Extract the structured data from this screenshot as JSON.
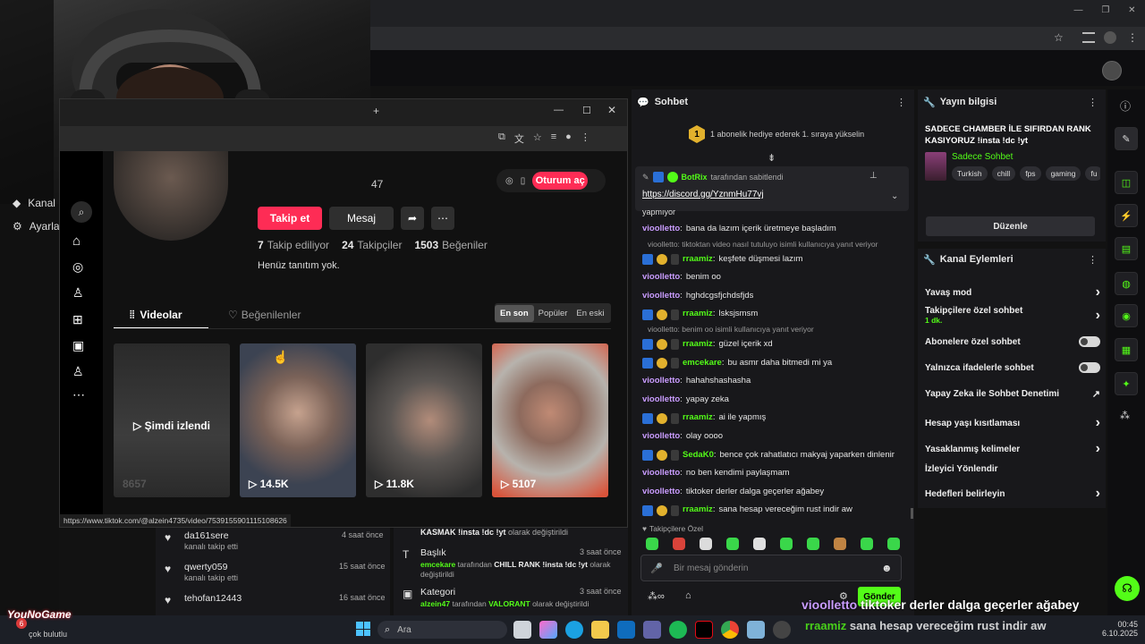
{
  "chrome": {
    "minimize": "—",
    "restore": "❐",
    "close": "✕"
  },
  "left_nav": {
    "item1": "Kanal",
    "item2": "Ayarlar"
  },
  "tiktok": {
    "login_button": "Oturum aç",
    "username_fragment": "47",
    "follow_label": "Takip et",
    "message_label": "Mesaj",
    "following_count": "7",
    "following_label": "Takip ediliyor",
    "followers_count": "24",
    "followers_label": "Takipçiler",
    "likes_count": "1503",
    "likes_label": "Beğeniler",
    "bio": "Henüz tanıtım yok.",
    "tab_videos": "Videolar",
    "tab_liked": "Beğenilenler",
    "sort_latest": "En son",
    "sort_popular": "Popüler",
    "sort_oldest": "En eski",
    "now_watched": "Şimdi izlendi",
    "videos": [
      {
        "views": "8657"
      },
      {
        "views": "14.5K"
      },
      {
        "views": "11.8K"
      },
      {
        "views": "5107"
      }
    ],
    "status_url": "https://www.tiktok.com/@alzein4735/video/7539155901115108626"
  },
  "feed_left": [
    {
      "name": "da161sere",
      "action": "kanalı takip etti",
      "time": "4 saat önce"
    },
    {
      "name": "qwerty059",
      "action": "kanalı takip etti",
      "time": "15 saat önce"
    },
    {
      "name": "tehofan12443",
      "action": "",
      "time": "16 saat önce"
    }
  ],
  "feed_mid": {
    "top_text": "KASMAK !insta !dc !yt",
    "top_suffix": "olarak değiştirildi",
    "title_label": "Başlık",
    "title_time": "3 saat önce",
    "title_user": "emcekare",
    "title_mid": "tarafından",
    "title_value": "CHILL RANK !insta !dc !yt",
    "title_suffix": "olarak değiştirildi",
    "cat_label": "Kategori",
    "cat_time": "3 saat önce",
    "cat_user": "alzein47",
    "cat_mid": "tarafından",
    "cat_value": "VALORANT",
    "cat_suffix": "olarak değiştirildi"
  },
  "chat": {
    "header": "Sohbet",
    "gift_text": "1 abonelik hediye ederek 1. sıraya yükselin",
    "gift_rank": "1",
    "pinned_by_user": "BotRix",
    "pinned_by_text": "tarafından sabitlendi",
    "pinned_link": "https://discord.gg/YznmHu77vj",
    "partial_top": "yapmıyor",
    "messages": [
      {
        "type": "msg",
        "user": "vioolletto",
        "color": "purple",
        "badges": false,
        "text": "bana da lazım içerik üretmeye başladım"
      },
      {
        "type": "reply",
        "text": "vioolletto: tiktoktan video nasıl tutuluyo isimli kullanıcıya yanıt veriyor"
      },
      {
        "type": "msg",
        "user": "rraamiz",
        "color": "green",
        "badges": true,
        "text": "keşfete düşmesi lazım"
      },
      {
        "type": "msg",
        "user": "vioolletto",
        "color": "purple",
        "badges": false,
        "text": "benim oo"
      },
      {
        "type": "msg",
        "user": "vioolletto",
        "color": "purple",
        "badges": false,
        "text": "hghdcgsfjchdsfjds"
      },
      {
        "type": "msg",
        "user": "rraamiz",
        "color": "green",
        "badges": true,
        "text": "lsksjsmsm"
      },
      {
        "type": "reply",
        "text": "vioolletto: benim oo isimli kullanıcıya yanıt veriyor"
      },
      {
        "type": "msg",
        "user": "rraamiz",
        "color": "green",
        "badges": true,
        "text": "güzel içerik xd"
      },
      {
        "type": "msg",
        "user": "emcekare",
        "color": "green",
        "badges": true,
        "text": "bu asmr daha bitmedi mi ya"
      },
      {
        "type": "msg",
        "user": "vioolletto",
        "color": "purple",
        "badges": false,
        "text": "hahahshashasha"
      },
      {
        "type": "msg",
        "user": "vioolletto",
        "color": "purple",
        "badges": false,
        "text": "yapay zeka"
      },
      {
        "type": "msg",
        "user": "rraamiz",
        "color": "green",
        "badges": true,
        "text": "ai ile yapmış"
      },
      {
        "type": "msg",
        "user": "vioolletto",
        "color": "purple",
        "badges": false,
        "text": "olay oooo"
      },
      {
        "type": "msg",
        "user": "SedaK0",
        "color": "green",
        "badges": true,
        "text": "bence çok rahatlatıcı makyaj yaparken dinlenir"
      },
      {
        "type": "msg",
        "user": "vioolletto",
        "color": "purple",
        "badges": false,
        "text": "no ben kendimi paylaşmam"
      },
      {
        "type": "msg",
        "user": "vioolletto",
        "color": "purple",
        "badges": false,
        "text": "tiktoker derler dalga geçerler ağabey"
      },
      {
        "type": "msg",
        "user": "rraamiz",
        "color": "green",
        "badges": true,
        "text": "sana hesap vereceğim rust indir aw"
      }
    ],
    "followers_only": "Takipçilere Özel",
    "input_placeholder": "Bir mesaj gönderin",
    "send_label": "Gönder"
  },
  "stream_info": {
    "header": "Yayın bilgisi",
    "title": "SADECE CHAMBER İLE SIFIRDAN RANK KASIYORUZ !insta !dc !yt",
    "category": "Sadece Sohbet",
    "tags": [
      "Turkish",
      "chill",
      "fps",
      "gaming",
      "fu"
    ],
    "edit_label": "Düzenle"
  },
  "channel_actions": {
    "header": "Kanal Eylemleri",
    "items": [
      {
        "label": "Yavaş mod",
        "sub": "",
        "control": "chevron"
      },
      {
        "label": "Takipçilere özel sohbet",
        "sub": "1 dk.",
        "control": "chevron"
      },
      {
        "label": "Abonelere özel sohbet",
        "sub": "",
        "control": "toggle"
      },
      {
        "label": "Yalnızca ifadelerle sohbet",
        "sub": "",
        "control": "toggle"
      },
      {
        "label": "Yapay Zeka ile Sohbet Denetimi",
        "sub": "",
        "control": "external"
      },
      {
        "label": "Hesap yaşı kısıtlaması",
        "sub": "",
        "control": "chevron"
      },
      {
        "label": "Yasaklanmış kelimeler",
        "sub": "",
        "control": "chevron"
      },
      {
        "label": "İzleyici Yönlendir",
        "sub": "",
        "control": "none"
      },
      {
        "label": "Hedefleri belirleyin",
        "sub": "",
        "control": "chevron"
      }
    ]
  },
  "overlay": {
    "user1": "vioolletto",
    "text1": "tiktoker derler dalga geçerler ağabey",
    "user2": "rraamiz",
    "text2": "sana hesap vereceğim rust indir aw"
  },
  "taskbar": {
    "search_placeholder": "Ara",
    "time": "00:45",
    "date": "6.10.2025",
    "notification": "6",
    "status_text": "çok bulutlu",
    "watermark": "YouNoGame"
  },
  "colors": {
    "kick_green": "#53fc18",
    "tiktok_red": "#fe2c55",
    "username_purple": "#c99cff"
  }
}
